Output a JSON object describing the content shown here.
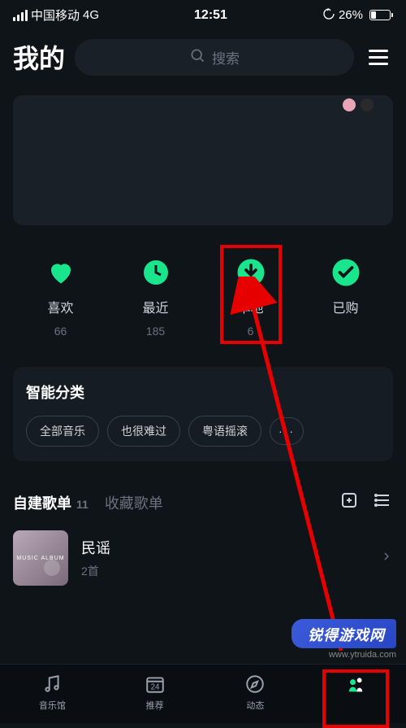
{
  "status": {
    "carrier": "中国移动",
    "network": "4G",
    "time": "12:51",
    "battery_pct": "26%"
  },
  "header": {
    "title": "我的",
    "search_placeholder": "搜索"
  },
  "shortcuts": [
    {
      "label": "喜欢",
      "count": "66"
    },
    {
      "label": "最近",
      "count": "185"
    },
    {
      "label": "本地",
      "count": "6"
    },
    {
      "label": "已购",
      "count": ""
    }
  ],
  "smart_category": {
    "title": "智能分类",
    "chips": [
      "全部音乐",
      "也很难过",
      "粤语摇滚"
    ],
    "more": "···"
  },
  "playlist": {
    "tabs": {
      "created": "自建歌单",
      "created_count": "11",
      "favorite": "收藏歌单"
    },
    "items": [
      {
        "name": "民谣",
        "meta": "2首",
        "cover_text": "MUSIC ALBUM"
      }
    ]
  },
  "nav": [
    {
      "label": "音乐馆"
    },
    {
      "label": "推荐",
      "badge": "24"
    },
    {
      "label": "动态"
    },
    {
      "label": ""
    }
  ],
  "watermark": {
    "main": "锐得游戏网",
    "sub": "www.ytruida.com"
  },
  "colors": {
    "accent": "#19e68c",
    "highlight": "#e60000"
  }
}
